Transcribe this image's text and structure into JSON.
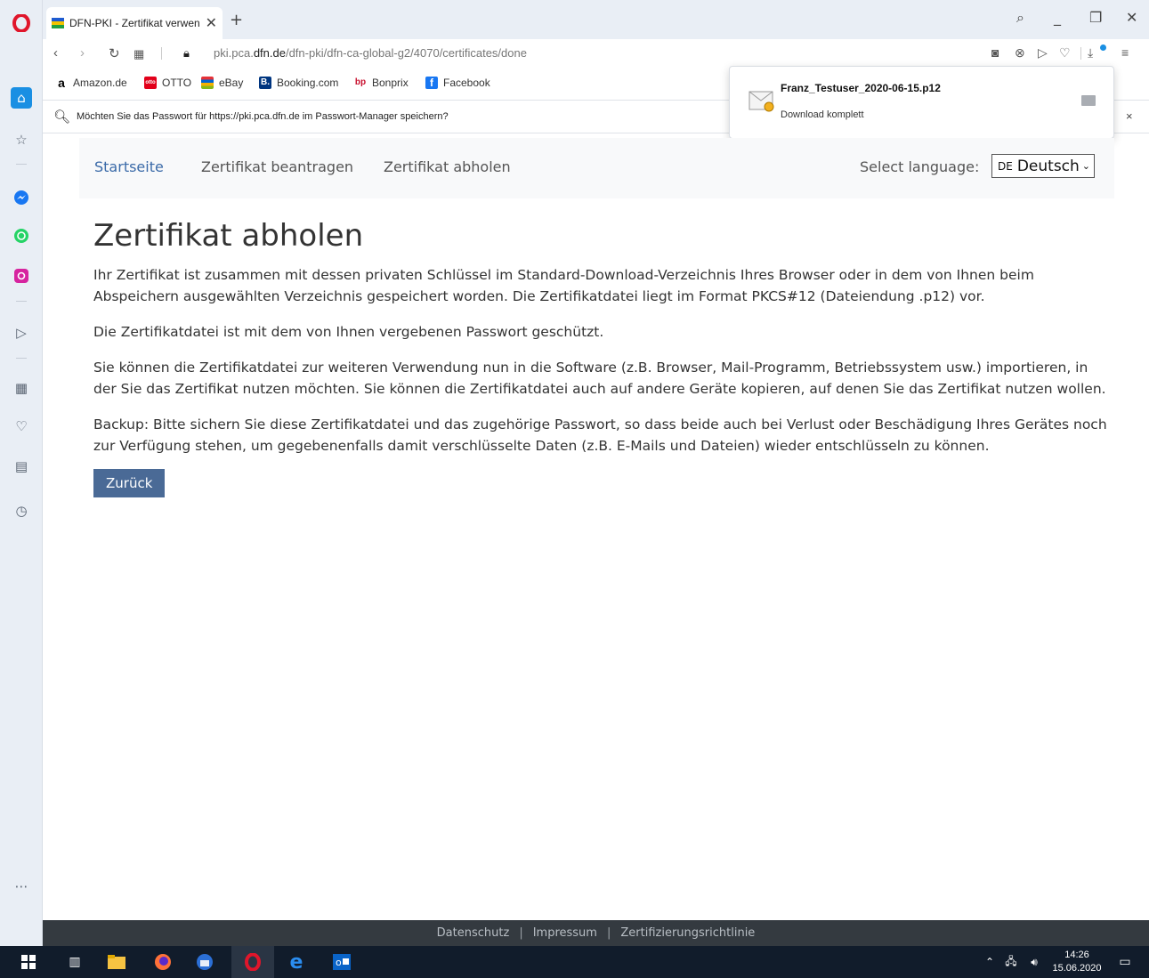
{
  "browser": {
    "tab_title": "DFN-PKI - Zertifikat verwen",
    "new_tab": "+",
    "url_host_pre": "pki.pca.",
    "url_host_main": "dfn.de",
    "url_path": "/dfn-pki/dfn-ca-global-g2/4070/certificates/done",
    "bookmarks": [
      {
        "label": "Amazon.de",
        "icon": "a"
      },
      {
        "label": "OTTO",
        "icon": "otto"
      },
      {
        "label": "eBay",
        "icon": "bag"
      },
      {
        "label": "Booking.com",
        "icon": "B."
      },
      {
        "label": "Bonprix",
        "icon": "bp"
      },
      {
        "label": "Facebook",
        "icon": "f"
      }
    ],
    "password_prompt": "Möchten Sie das Passwort für https://pki.pca.dfn.de im Passwort-Manager speichern?",
    "password_close": "×"
  },
  "download": {
    "filename": "Franz_Testuser_2020-06-15.p12",
    "status": "Download komplett"
  },
  "nav": {
    "home": "Startseite",
    "request": "Zertifikat beantragen",
    "retrieve": "Zertifikat abholen",
    "lang_label": "Select language:",
    "lang_code": "DE",
    "lang_value": "Deutsch"
  },
  "main": {
    "title": "Zertifikat abholen",
    "p1": "Ihr Zertifikat ist zusammen mit dessen privaten Schlüssel im Standard-Download-Verzeichnis Ihres Browser oder in dem von Ihnen beim Abspeichern ausgewählten Verzeichnis gespeichert worden. Die Zertifikatdatei liegt im Format PKCS#12 (Dateiendung .p12) vor.",
    "p2": "Die Zertifikatdatei ist mit dem von Ihnen vergebenen Passwort geschützt.",
    "p3": "Sie können die Zertifikatdatei zur weiteren Verwendung nun in die Software (z.B. Browser, Mail-Programm, Betriebssystem usw.) importieren, in der Sie das Zertifikat nutzen möchten. Sie können die Zertifikatdatei auch auf andere Geräte kopieren, auf denen Sie das Zertifikat nutzen wollen.",
    "p4": "Backup: Bitte sichern Sie diese Zertifikatdatei und das zugehörige Passwort, so dass beide auch bei Verlust oder Beschädigung Ihres Gerätes noch zur Verfügung stehen, um gegebenenfalls damit verschlüsselte Daten (z.B. E-Mails und Dateien) wieder entschlüsseln zu können.",
    "back_button": "Zurück"
  },
  "footer": {
    "privacy": "Datenschutz",
    "imprint": "Impressum",
    "policy": "Zertifizierungsrichtlinie",
    "separator": "|"
  },
  "taskbar": {
    "time": "14:26",
    "date": "15.06.2020"
  },
  "colors": {
    "button": "#4a6a96",
    "footer": "#343a40",
    "taskbar": "#111c2b",
    "opera_red": "#e0162b"
  }
}
